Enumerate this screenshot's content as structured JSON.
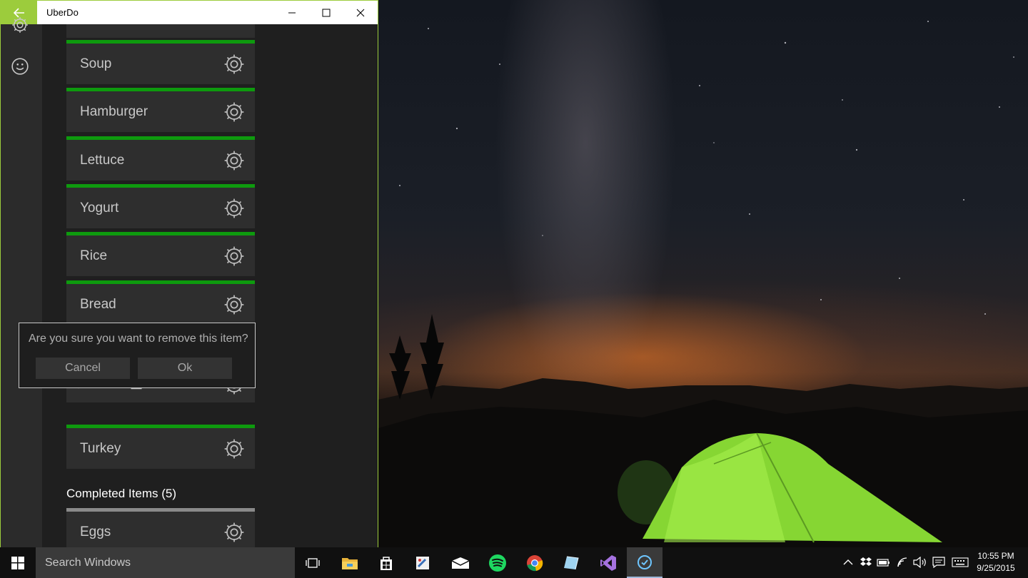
{
  "window": {
    "title": "UberDo",
    "back_icon": "arrow-left-icon",
    "accent": "#9ccc3c"
  },
  "sidebar": {
    "icons": [
      "gear-icon",
      "smiley-icon"
    ]
  },
  "list": {
    "active_stripe_color": "#0e9a0e",
    "items": [
      {
        "label": "Soup"
      },
      {
        "label": "Hamburger"
      },
      {
        "label": "Lettuce"
      },
      {
        "label": "Yogurt"
      },
      {
        "label": "Rice"
      },
      {
        "label": "Bread"
      }
    ],
    "expanded_item_actions": [
      "pencil-icon",
      "trash-icon"
    ],
    "after_dialog_item": {
      "label": "Turkey"
    },
    "completed_header": "Completed Items (5)",
    "completed_items": [
      {
        "label": "Eggs"
      }
    ]
  },
  "dialog": {
    "message": "Are you sure you want to remove this item?",
    "cancel_label": "Cancel",
    "ok_label": "Ok"
  },
  "taskbar": {
    "search_placeholder": "Search Windows",
    "apps": [
      "task-view-icon",
      "file-explorer-icon",
      "store-icon",
      "paint-icon",
      "mail-icon",
      "spotify-icon",
      "chrome-icon",
      "notepad-icon",
      "visual-studio-icon",
      "uberdo-icon"
    ],
    "tray": [
      "chevron-up-icon",
      "dropbox-icon",
      "battery-icon",
      "wifi-icon",
      "volume-icon",
      "notifications-icon",
      "keyboard-icon"
    ],
    "time": "10:55 PM",
    "date": "9/25/2015"
  }
}
